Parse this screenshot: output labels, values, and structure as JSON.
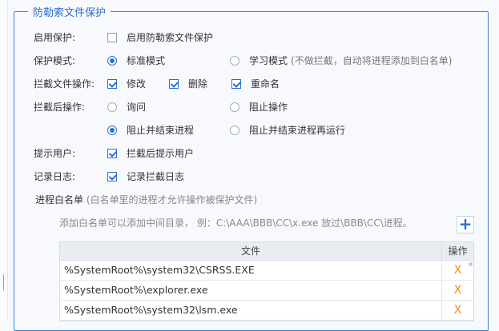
{
  "section": {
    "title": "防勒索文件保护"
  },
  "rows": {
    "enable": {
      "label": "启用保护:",
      "checkbox_label": "启用防勒索文件保护",
      "checked": false
    },
    "mode": {
      "label": "保护模式:",
      "standard": {
        "label": "标准模式",
        "selected": true
      },
      "learning": {
        "label": "学习模式",
        "hint": "(不做拦截，自动将进程添加到白名单)",
        "selected": false
      }
    },
    "intercept_ops": {
      "label": "拦截文件操作:",
      "modify": {
        "label": "修改",
        "checked": true
      },
      "delete": {
        "label": "删除",
        "checked": true
      },
      "rename": {
        "label": "重命名",
        "checked": true
      }
    },
    "after_ops": {
      "label": "拦截后操作:",
      "ask": {
        "label": "询问",
        "selected": false
      },
      "block": {
        "label": "阻止操作",
        "selected": false
      },
      "block_end": {
        "label": "阻止并结束进程",
        "selected": true
      },
      "block_end_restart": {
        "label": "阻止并结束进程再运行",
        "selected": false
      }
    },
    "notify": {
      "label": "提示用户:",
      "checkbox_label": "拦截后提示用户",
      "checked": true
    },
    "log": {
      "label": "记录日志:",
      "checkbox_label": "记录拦截日志",
      "checked": true
    }
  },
  "whitelist": {
    "title": "进程白名单",
    "subtitle": "(白名单里的进程才允许操作被保护文件)",
    "note": "添加白名单可以添加中间目录，  例：C:\\AAA\\BBB\\CC\\x.exe 放过\\BBB\\CC\\进程。",
    "add_button": "+",
    "columns": {
      "file": "文件",
      "action": "操作"
    },
    "items": [
      {
        "file": "%SystemRoot%\\system32\\CSRSS.EXE",
        "action": "X"
      },
      {
        "file": "%SystemRoot%\\explorer.exe",
        "action": "X"
      },
      {
        "file": "%SystemRoot%\\system32\\lsm.exe",
        "action": "X"
      }
    ]
  },
  "colors": {
    "accent": "#2b6ed1",
    "border": "#3b82d6",
    "delete": "#f08a1c"
  }
}
